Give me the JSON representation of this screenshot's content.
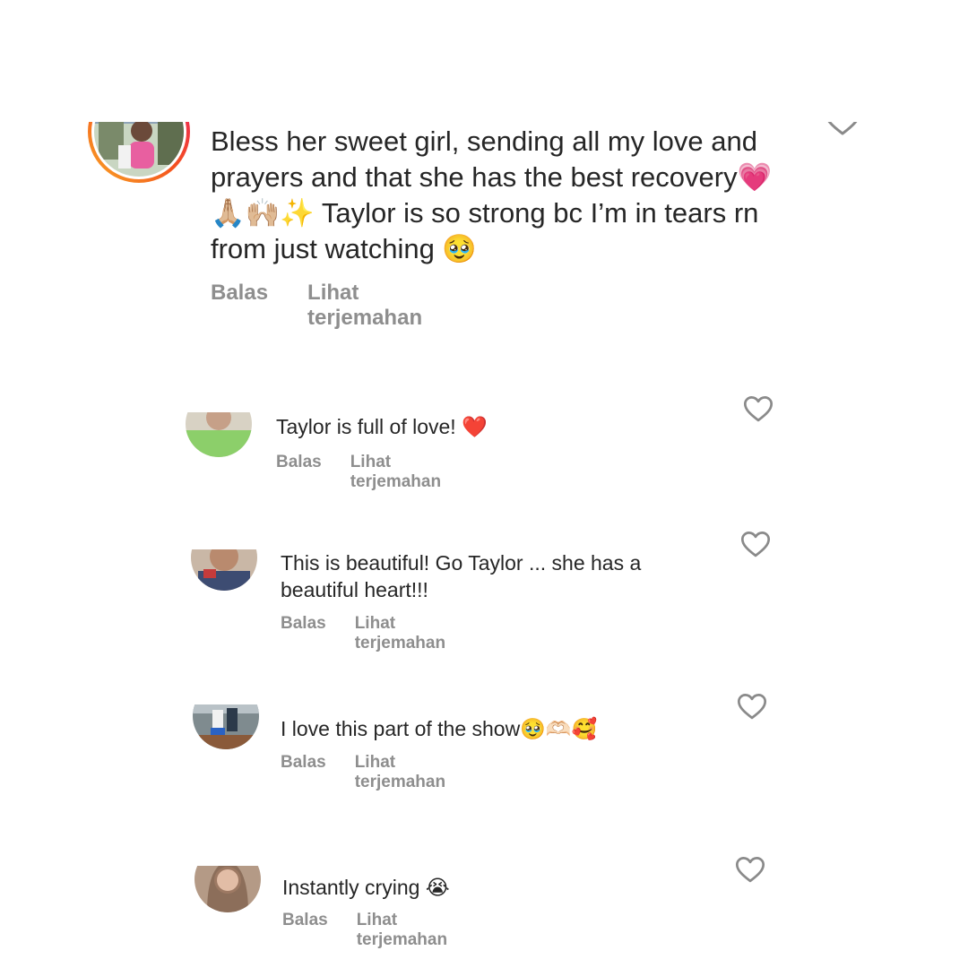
{
  "comments": [
    {
      "text": "Bless her sweet girl, sending all my love and prayers and that she has the best recovery💗🙏🏼🙌🏼✨ Taylor is so strong bc I’m in tears rn from just watching 🥹",
      "reply_label": "Balas",
      "translate_label": "Lihat terjemahan",
      "avatar_story_ring": true,
      "like_icon": "heart-outline-icon"
    },
    {
      "text": "Taylor is full of love! ❤️",
      "reply_label": "Balas",
      "translate_label": "Lihat terjemahan",
      "like_icon": "heart-outline-icon"
    },
    {
      "text": "This is beautiful! Go Taylor ... she has a beautiful heart!!!",
      "reply_label": "Balas",
      "translate_label": "Lihat terjemahan",
      "like_icon": "heart-outline-icon"
    },
    {
      "text": "I love this part of the show🥹🫶🏻🥰",
      "reply_label": "Balas",
      "translate_label": "Lihat terjemahan",
      "like_icon": "heart-outline-icon"
    },
    {
      "text": "Instantly crying 😭",
      "reply_label": "Balas",
      "translate_label": "Lihat terjemahan",
      "like_icon": "heart-outline-icon"
    }
  ],
  "colors": {
    "text": "#262626",
    "secondary": "#8e8e8e",
    "story_ring_start": "#f9a825",
    "story_ring_end": "#e91e63"
  }
}
